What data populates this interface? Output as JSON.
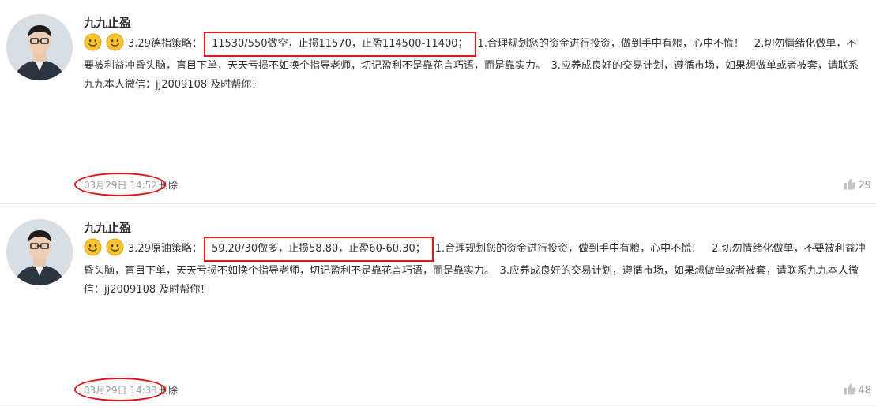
{
  "posts": [
    {
      "author": "九九止盈",
      "prefix": "3.29德指策略：",
      "highlight": "11530/550做空，止损11570，止盈114500-11400；",
      "body": "1.合理规划您的资金进行投资，做到手中有粮，心中不慌！　2.切勿情绪化做单，不要被利益冲昏头脑，盲目下单，天天亏损不如换个指导老师，切记盈利不是靠花言巧语，而是靠实力。　3.应养成良好的交易计划，遵循市场，如果想做单或者被套，请联系九九本人微信：jj2009108 及时帮你！",
      "time": "03月29日 14:52",
      "delete_label": "删除",
      "likes": "29"
    },
    {
      "author": "九九止盈",
      "prefix": "3.29原油策略：",
      "highlight": "59.20/30做多，止损58.80，止盈60-60.30；",
      "body": "1.合理规划您的资金进行投资，做到手中有粮，心中不慌！　2.切勿情绪化做单，不要被利益冲昏头脑，盲目下单，天天亏损不如换个指导老师，切记盈利不是靠花言巧语，而是靠实力。　3.应养成良好的交易计划，遵循市场，如果想做单或者被套，请联系九九本人微信：jj2009108 及时帮你！",
      "time": "03月29日 14:33",
      "delete_label": "删除",
      "likes": "48"
    }
  ],
  "colors": {
    "highlight_border": "#e0141c",
    "time_text": "#9a9a9a",
    "divider": "#e6e6e6"
  },
  "icons": {
    "emoji": "smiley-icon",
    "like": "thumbs-up-icon"
  }
}
